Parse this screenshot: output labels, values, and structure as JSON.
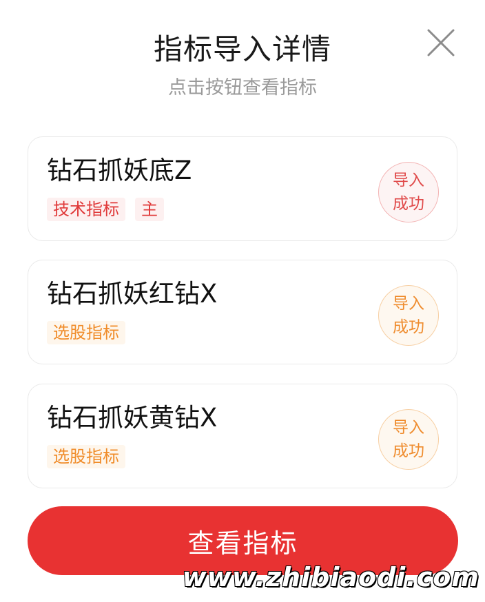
{
  "header": {
    "title": "指标导入详情",
    "subtitle": "点击按钮查看指标",
    "close_icon": "close-icon"
  },
  "cards": [
    {
      "name": "钻石抓妖底Z",
      "tags": [
        "技术指标",
        "主"
      ],
      "tag_color": "#e03a3a",
      "status_line1": "导入",
      "status_line2": "成功"
    },
    {
      "name": "钻石抓妖红钻X",
      "tags": [
        "选股指标"
      ],
      "tag_color": "#f08c2a",
      "status_line1": "导入",
      "status_line2": "成功"
    },
    {
      "name": "钻石抓妖黄钻X",
      "tags": [
        "选股指标"
      ],
      "tag_color": "#f08c2a",
      "status_line1": "导入",
      "status_line2": "成功"
    }
  ],
  "footer": {
    "button_label": "查看指标",
    "button_color": "#e83232"
  },
  "watermark": "www.zhibiaodi.com"
}
